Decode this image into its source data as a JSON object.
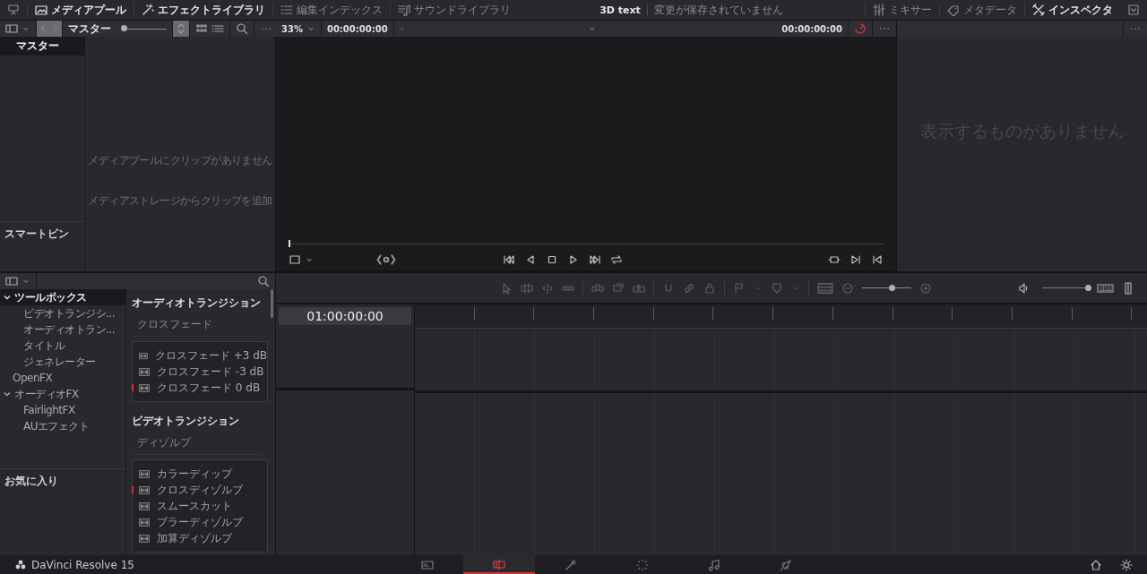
{
  "topbar": {
    "left_tabs": [
      {
        "label": "メディアプール",
        "kind": "media-pool",
        "selected": true
      },
      {
        "label": "エフェクトライブラリ",
        "kind": "effects",
        "selected": true
      },
      {
        "label": "編集インデックス",
        "kind": "index",
        "selected": false
      },
      {
        "label": "サウンドライブラリ",
        "kind": "sound",
        "selected": false
      }
    ],
    "project_title": "3D text",
    "save_status": "変更が保存されていません",
    "right_tabs": [
      {
        "label": "ミキサー",
        "kind": "mixer",
        "selected": false
      },
      {
        "label": "メタデータ",
        "kind": "metadata",
        "selected": false
      },
      {
        "label": "インスペクタ",
        "kind": "inspector",
        "selected": true
      }
    ]
  },
  "media_pool": {
    "current_bin": "マスター",
    "thumbnail_slider": {
      "level": 0
    },
    "bins": [
      {
        "label": "マスター",
        "selected": true
      }
    ],
    "smart_bins_label": "スマートビン",
    "empty_message": "メディアプールにクリップがありません",
    "empty_hint": "メディアストレージからクリップを追加"
  },
  "viewer": {
    "zoom": "33%",
    "source_timecode": "00:00:00:00",
    "timecode": "00:00:00:00",
    "playhead": {
      "level": 0
    }
  },
  "inspector": {
    "empty_message": "表示するものがありません"
  },
  "effects_library": {
    "tree": [
      {
        "label": "ツールボックス",
        "selected": true,
        "expanded": true,
        "children": [
          {
            "label": "ビデオトランジシ...",
            "selected": false
          },
          {
            "label": "オーディオトラン...",
            "selected": false
          },
          {
            "label": "タイトル",
            "selected": false
          },
          {
            "label": "ジェネレーター",
            "selected": false
          }
        ]
      },
      {
        "label": "OpenFX",
        "selected": false
      },
      {
        "label": "オーディオFX",
        "selected": false,
        "expanded": true,
        "children": [
          {
            "label": "FairlightFX",
            "selected": false
          },
          {
            "label": "AUエフェクト",
            "selected": false
          }
        ]
      }
    ],
    "favorites_label": "お気に入り",
    "sections": [
      {
        "title": "オーディオトランジション",
        "groups": [
          {
            "title": "クロスフェード",
            "items": [
              {
                "label": "クロスフェード +3 dB",
                "marked": false
              },
              {
                "label": "クロスフェード -3 dB",
                "marked": false
              },
              {
                "label": "クロスフェード 0 dB",
                "marked": true
              }
            ]
          }
        ]
      },
      {
        "title": "ビデオトランジション",
        "groups": [
          {
            "title": "ディゾルブ",
            "items": [
              {
                "label": "カラーディップ",
                "marked": false
              },
              {
                "label": "クロスディゾルブ",
                "marked": true
              },
              {
                "label": "スムースカット",
                "marked": false
              },
              {
                "label": "ブラーディゾルブ",
                "marked": false
              },
              {
                "label": "加算ディゾルブ",
                "marked": false
              }
            ]
          }
        ]
      }
    ]
  },
  "timeline": {
    "timecode": "01:00:00:00",
    "zoom": {
      "level": 0.6
    },
    "volume": {
      "level": 1
    },
    "dim_label": "DIM"
  },
  "footer": {
    "app_name": "DaVinci Resolve 15",
    "pages": [
      {
        "kind": "media",
        "selected": false
      },
      {
        "kind": "edit",
        "selected": true
      },
      {
        "kind": "fusion",
        "selected": false
      },
      {
        "kind": "color",
        "selected": false
      },
      {
        "kind": "fairlight",
        "selected": false
      },
      {
        "kind": "deliver",
        "selected": false
      }
    ]
  }
}
